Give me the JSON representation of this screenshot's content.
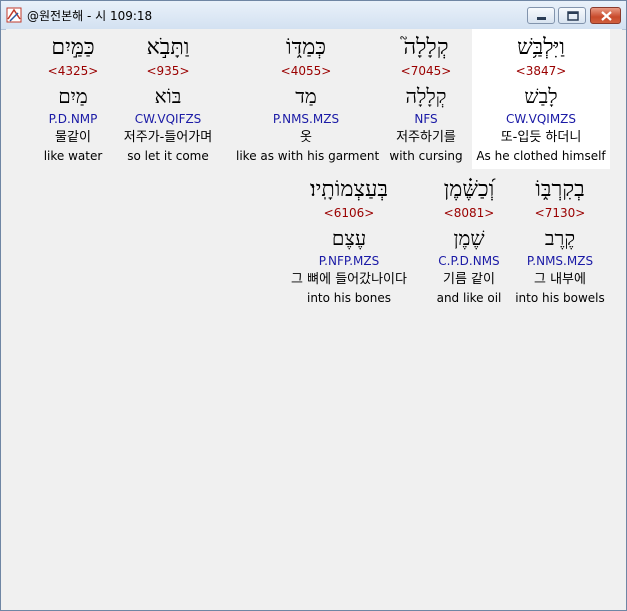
{
  "window": {
    "title": "@원전본해 - 시 109:18",
    "app_icon": "app-icon",
    "controls": {
      "minimize": "minimize-icon",
      "maximize": "maximize-icon",
      "close": "close-icon"
    }
  },
  "rows": [
    {
      "words": [
        {
          "hebrew": "כַּמַּ֣יִם",
          "strong": "<4325>",
          "lemma": "מַיִם",
          "morph": "P.D.NMP",
          "korean": "물같이",
          "english": "like water",
          "highlighted": false
        },
        {
          "hebrew": "וַתָּבֹ֣א",
          "strong": "<935>",
          "lemma": "בּוֹא",
          "morph": "CW.VQIFZS",
          "korean": "저주가-들어가며",
          "english": "so let it come",
          "highlighted": false
        },
        {
          "hebrew": "כְּמַדּ֑וֹ",
          "strong": "<4055>",
          "lemma": "מַד",
          "morph": "P.NMS.MZS",
          "korean": "옷",
          "english": "like as with his garment",
          "highlighted": false
        },
        {
          "hebrew": "קְלָלָה֮",
          "strong": "<7045>",
          "lemma": "קְלָלָה",
          "morph": "NFS",
          "korean": "저주하기를",
          "english": "with cursing",
          "highlighted": false
        },
        {
          "hebrew": "וַיִּלְבַּ֥שׁ",
          "strong": "<3847>",
          "lemma": "לָבַשׁ",
          "morph": "CW.VQIMZS",
          "korean": "또-입듯 하더니",
          "english": "As he clothed himself",
          "highlighted": true
        }
      ]
    },
    {
      "words": [
        {
          "hebrew": "בְּעַצְמוֹתָֽיו׃",
          "strong": "<6106>",
          "lemma": "עֶצֶם",
          "morph": "P.NFP.MZS",
          "korean": "그 뼈에 들어갔나이다",
          "english": "into his bones",
          "highlighted": false
        },
        {
          "hebrew": "וְ֝כַשֶּׁ֗מֶן",
          "strong": "<8081>",
          "lemma": "שֶׁמֶן",
          "morph": "C.P.D.NMS",
          "korean": "기름 같이",
          "english": "and like oil",
          "highlighted": false
        },
        {
          "hebrew": "בְקִרְבּ֑וֹ",
          "strong": "<7130>",
          "lemma": "קֶרֶב",
          "morph": "P.NMS.MZS",
          "korean": "그 내부에",
          "english": "into his bowels",
          "highlighted": false
        }
      ]
    }
  ]
}
